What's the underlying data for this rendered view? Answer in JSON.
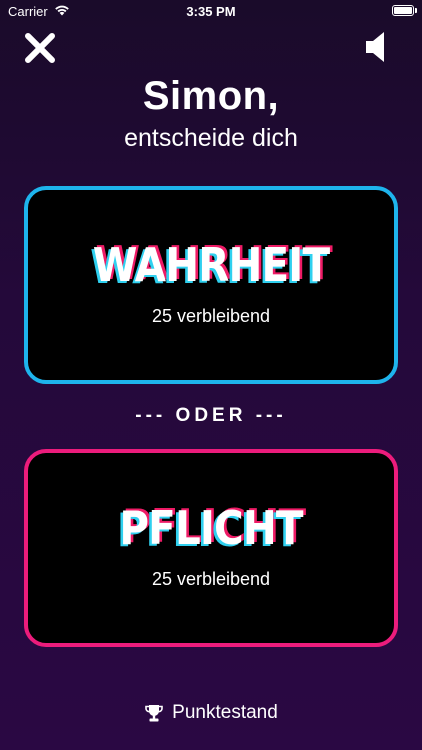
{
  "status_bar": {
    "carrier": "Carrier",
    "time": "3:35 PM"
  },
  "header": {
    "title": "Simon,",
    "subtitle": "entscheide dich"
  },
  "choices": {
    "truth": {
      "label": "WAHRHEIT",
      "remaining": "25 verbleibend",
      "border_color": "#1eb4ec"
    },
    "dare": {
      "label": "PFLICHT",
      "remaining": "25 verbleibend",
      "border_color": "#ec1c7c"
    }
  },
  "divider": {
    "label": "--- ODER ---"
  },
  "footer": {
    "score_label": "Punktestand",
    "icon": "trophy-icon"
  },
  "icons": {
    "close": "close-icon",
    "sound": "speaker-icon",
    "wifi": "wifi-icon",
    "battery": "battery-icon"
  }
}
